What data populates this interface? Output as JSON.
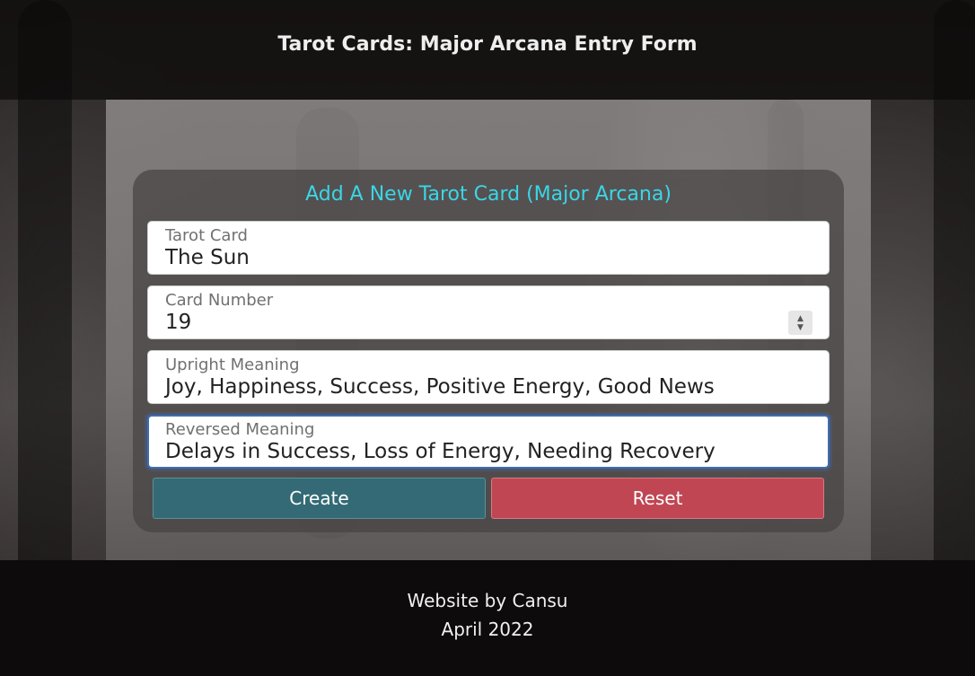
{
  "header": {
    "title": "Tarot Cards: Major Arcana Entry Form"
  },
  "form": {
    "title": "Add A New Tarot Card (Major Arcana)",
    "fields": [
      {
        "label": "Tarot Card",
        "value": "The Sun"
      },
      {
        "label": "Card Number",
        "value": "19"
      },
      {
        "label": "Upright Meaning",
        "value": "Joy, Happiness, Success, Positive Energy, Good News"
      },
      {
        "label": "Reversed Meaning",
        "value": "Delays in Success, Loss of Energy, Needing Recovery"
      }
    ],
    "create_label": "Create",
    "reset_label": "Reset"
  },
  "footer": {
    "credit": "Website by Cansu",
    "date": "April 2022"
  },
  "colors": {
    "form_title": "#3ad6e6",
    "create_button": "#336a75",
    "reset_button": "#c04653",
    "focus_ring": "#3e6db5"
  }
}
